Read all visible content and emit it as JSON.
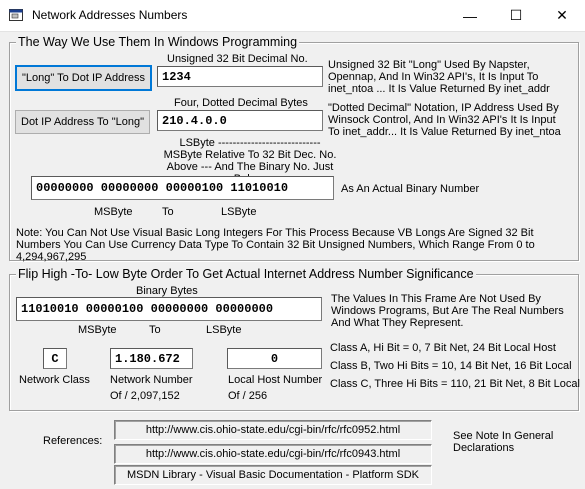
{
  "window": {
    "title": "Network Addresses Numbers",
    "controls": {
      "minimize": "—",
      "maximize": "☐",
      "close": "✕"
    }
  },
  "frame1": {
    "title": "The Way We Use Them In Windows Programming",
    "unsigned_caption": "Unsigned 32 Bit Decimal No.",
    "long_to_dot_button": "\"Long\" To Dot IP Address",
    "long_value": "1234",
    "long_desc": "Unsigned 32 Bit \"Long\" Used By Napster, Opennap, And  In Win32 API's, It Is Input To inet_ntoa ... It Is Value Returned By inet_addr",
    "dotted_caption": "Four, Dotted Decimal Bytes",
    "dot_to_long_button": "Dot IP Address To \"Long\"",
    "dotted_value": "210.4.0.0",
    "dotted_desc": "\"Dotted Decimal\" Notation, IP Address Used By Winsock Control, And In Win32 API's It Is Input To inet_addr... It Is Value Returned By inet_ntoa",
    "lsbyte_note": "LSByte ---------------------------- MSByte Relative To 32 Bit Dec. No. Above --- And The Binary No. Just Below.",
    "binary_value": "00000000 00000000 00000100 11010010",
    "binary_label": "As An Actual Binary Number",
    "msbyte_label": "MSByte",
    "to_label": "To",
    "lsbyte_label": "LSByte",
    "note": "Note: You Can Not Use Visual Basic Long Integers For This Process Because VB Longs Are Signed 32 Bit Numbers You Can Use Currency Data Type To Contain 32 Bit Unsigned  Numbers, Which Range From 0 to 4,294,967,295"
  },
  "frame2": {
    "title": "Flip High -To- Low Byte Order To Get Actual Internet Address Number Significance",
    "binary_caption": "Binary Bytes",
    "binary_value": "11010010 00000100 00000000 00000000",
    "msbyte_label": "MSByte",
    "to_label": "To",
    "lsbyte_label": "LSByte",
    "frame_desc": "The Values In This Frame Are Not Used By Windows Programs, But Are The Real Numbers And What They Represent.",
    "class_value": "C",
    "class_label": "Network Class",
    "network_value": "1.180.672",
    "network_label": "Network Number",
    "network_of": "Of / 2,097,152",
    "host_value": "0",
    "host_label": "Local Host Number",
    "host_of": "Of / 256",
    "class_a": "Class A, Hi Bit = 0, 7 Bit Net, 24 Bit Local Host",
    "class_b": "Class B, Two Hi Bits = 10, 14 Bit Net, 16 Bit Local",
    "class_c": "Class C, Three Hi Bits = 110, 21 Bit Net, 8 Bit Local"
  },
  "references": {
    "label": "References:",
    "url1": "http://www.cis.ohio-state.edu/cgi-bin/rfc/rfc0952.html",
    "url2": "http://www.cis.ohio-state.edu/cgi-bin/rfc/rfc0943.html",
    "msdn": "MSDN Library - Visual Basic Documentation - Platform SDK",
    "see_note": "See Note In General Declarations"
  }
}
